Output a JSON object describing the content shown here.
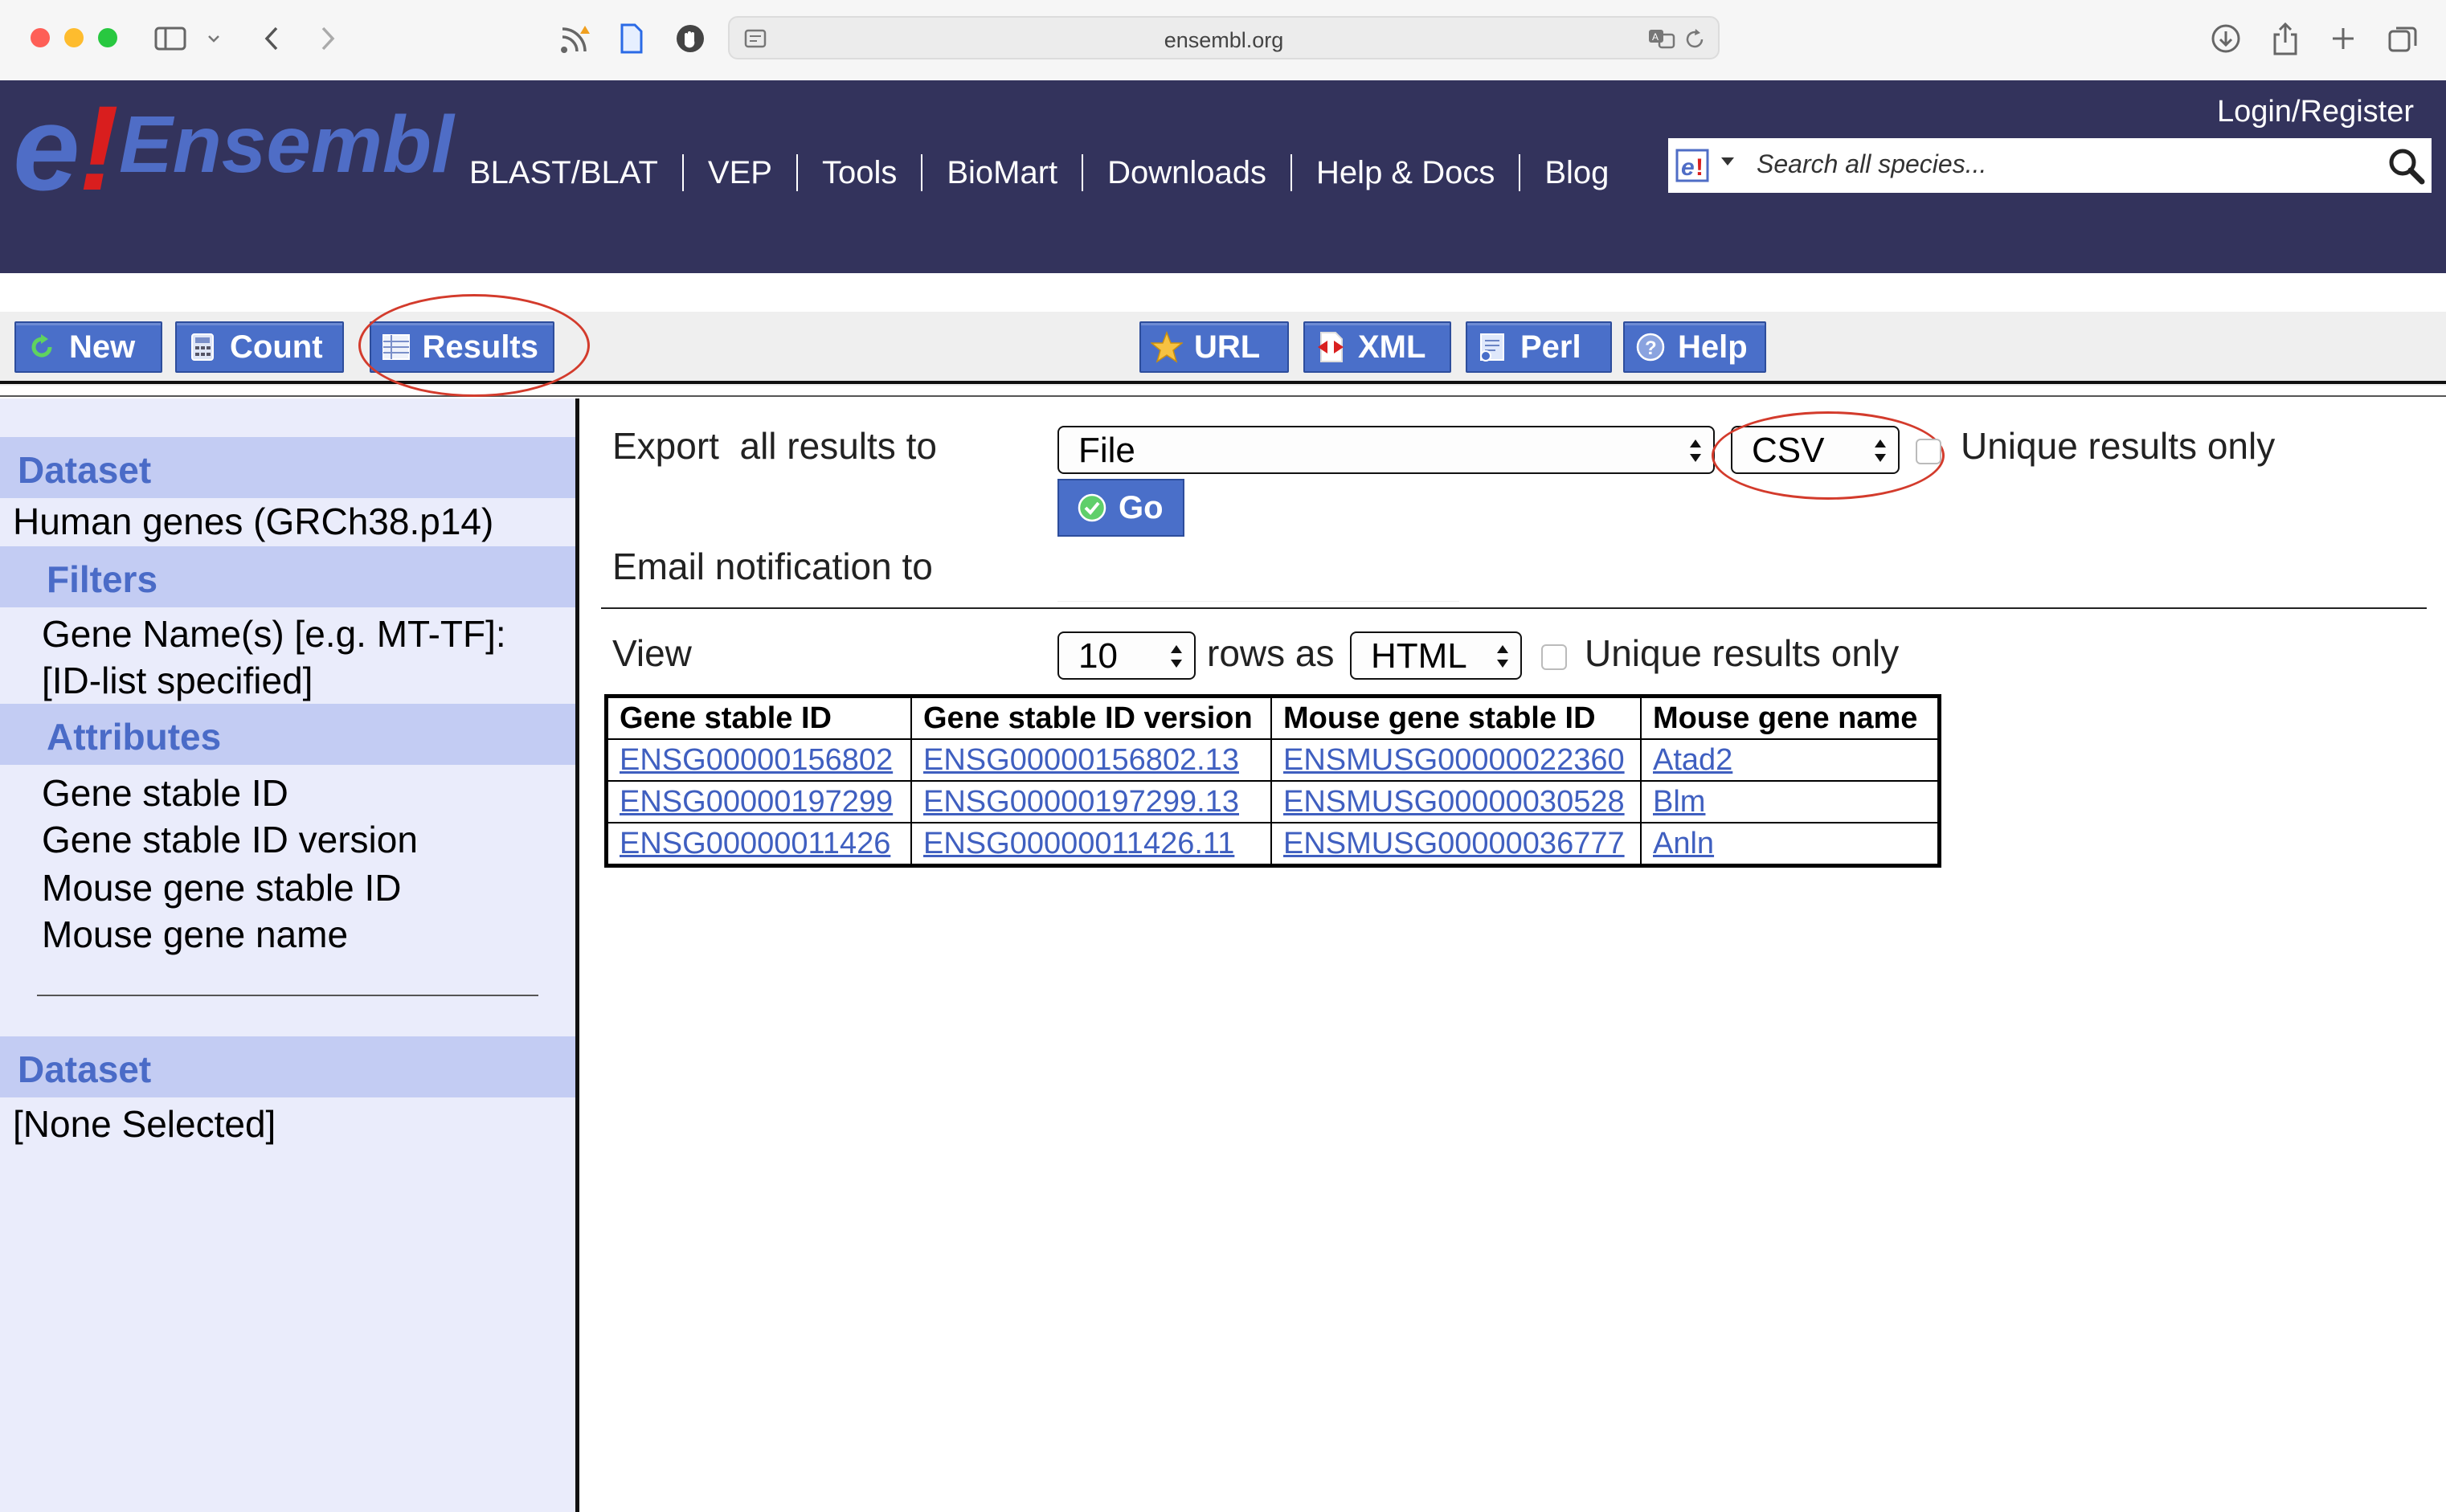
{
  "browser": {
    "url": "ensembl.org",
    "icons": [
      "sidebar-icon",
      "chevron-down-icon",
      "back-icon",
      "forward-icon",
      "rss-icon",
      "document-icon",
      "privacy-shield-icon",
      "reader-icon",
      "translate-icon",
      "reload-icon",
      "download-icon",
      "share-icon",
      "new-tab-icon",
      "tabs-overview-icon"
    ]
  },
  "header": {
    "logo_text": "e!Ensembl",
    "login": "Login/Register",
    "nav": [
      "BLAST/BLAT",
      "VEP",
      "Tools",
      "BioMart",
      "Downloads",
      "Help & Docs",
      "Blog"
    ],
    "search_placeholder": "Search all species..."
  },
  "toolbar": {
    "new": "New",
    "count": "Count",
    "results": "Results",
    "url": "URL",
    "xml": "XML",
    "perl": "Perl",
    "help": "Help"
  },
  "sidebar": {
    "dataset_heading": "Dataset",
    "dataset_value": "Human genes (GRCh38.p14)",
    "filters_heading": "Filters",
    "filter_line1": "Gene Name(s) [e.g. MT-TF]:",
    "filter_line2": "[ID-list specified]",
    "attributes_heading": "Attributes",
    "attributes": [
      "Gene stable ID",
      "Gene stable ID version",
      "Mouse gene stable ID",
      "Mouse gene name"
    ],
    "dataset2_heading": "Dataset",
    "dataset2_value": "[None Selected]"
  },
  "export": {
    "label": "Export  all results to",
    "destination": "File",
    "format": "CSV",
    "unique_label": "Unique results only",
    "unique_checked": false,
    "go": "Go",
    "email_label": "Email notification to"
  },
  "view": {
    "label": "View",
    "rows": "10",
    "rows_as": "rows as",
    "format": "HTML",
    "unique_label": "Unique results only",
    "unique_checked": false
  },
  "table": {
    "headers": [
      "Gene stable ID",
      "Gene stable ID version",
      "Mouse gene stable ID",
      "Mouse gene name"
    ],
    "rows": [
      [
        "ENSG00000156802",
        "ENSG00000156802.13",
        "ENSMUSG00000022360",
        "Atad2"
      ],
      [
        "ENSG00000197299",
        "ENSG00000197299.13",
        "ENSMUSG00000030528",
        "Blm"
      ],
      [
        "ENSG00000011426",
        "ENSG00000011426.11",
        "ENSMUSG00000036777",
        "Anln"
      ]
    ]
  },
  "colors": {
    "header_bg": "#33335c",
    "button_blue": "#4a6fc9",
    "sidebar_bg": "#eaecfb",
    "sidebar_heading_bg": "#c3ccf3",
    "heading_text": "#4a6bc7",
    "link": "#3f5fc0",
    "highlight_ellipse": "#d33b2c"
  }
}
